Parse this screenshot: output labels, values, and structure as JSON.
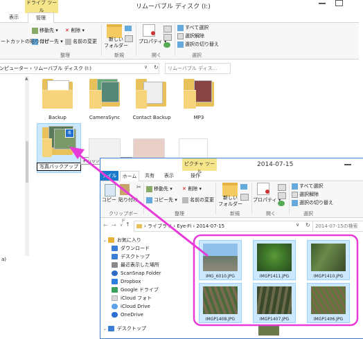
{
  "back_window": {
    "context_tab_top": "ドライブ ツール",
    "context_tab_bottom": "管理",
    "title": "リムーバブル ディスク (I:)",
    "tab_view": "表示",
    "ribbon": {
      "move_to": "移動先",
      "delete": "削除",
      "copy_to": "コピー先",
      "rename": "名前の変更",
      "paste_shortcut": "ョートカットの貼り付け",
      "new_folder": "新しい\nフォルダー",
      "properties": "プロパティ",
      "select_all": "すべて選択",
      "select_none": "選択解除",
      "invert_selection": "選択の切り替え",
      "group_organize": "整理",
      "group_new": "新規",
      "group_open": "開く",
      "group_select": "選択"
    },
    "address": "ンピューター › リムーバブル ディスク (I:)",
    "search_placeholder": "リムーバブル ディス...",
    "folders": [
      {
        "label": "Backup"
      },
      {
        "label": "CameraSync"
      },
      {
        "label": "Contact Backup"
      },
      {
        "label": "MP3"
      },
      {
        "label": "写真バックアップ"
      }
    ],
    "drag_tooltip": "+ バックアップ へコピー",
    "drag_badge": "6",
    "left_stub": "a)"
  },
  "front_window": {
    "context_tab_top": "",
    "context_tab_bottom": "ピクチャ ツール",
    "title": "2014-07-15",
    "tabs": {
      "file": "ァイル",
      "home": "ホーム",
      "share": "共有",
      "view": "表示",
      "manage": "操作"
    },
    "ribbon": {
      "copy": "コピー",
      "paste": "貼り付け",
      "move_to": "移動先",
      "copy_to": "コピー先",
      "delete": "削除",
      "rename": "名前の変更",
      "new_folder": "新しい\nフォルダー",
      "properties": "プロパティ",
      "select_all": "すべて選択",
      "select_none": "選択解除",
      "invert_selection": "選択の切り替え",
      "group_clipboard": "クリップボード",
      "group_organize": "整理",
      "group_new": "新規",
      "group_open": "開く",
      "group_select": "選択"
    },
    "address": {
      "seg1": "ライブラリ",
      "seg2": "Eye-Fi",
      "seg3": "2014-07-15"
    },
    "search_placeholder": "2014-07-15の検索",
    "nav": [
      {
        "label": "お気に入り",
        "color": "#e8b33b"
      },
      {
        "label": "ダウンロード",
        "color": "#3a7ed6"
      },
      {
        "label": "デスクトップ",
        "color": "#3a7ed6"
      },
      {
        "label": "最近表示した場所",
        "color": "#8a8a8a"
      },
      {
        "label": "ScanSnap Folder",
        "color": "#2c6cc9"
      },
      {
        "label": "Dropbox",
        "color": "#2c7fe0"
      },
      {
        "label": "Google ドライブ",
        "color": "#3aa35a"
      },
      {
        "label": "iCloud フォト",
        "color": "#d9d9d9"
      },
      {
        "label": "iCloud Drive",
        "color": "#5ba0e8"
      },
      {
        "label": "OneDrive",
        "color": "#2a6fd6"
      },
      {
        "label": "デスクトップ",
        "color": "#3a7ed6"
      }
    ],
    "thumbs": [
      {
        "name": "IMG_6010.JPG"
      },
      {
        "name": "IMGP1411.JPG"
      },
      {
        "name": "IMGP1410.JPG"
      },
      {
        "name": "IMGP1408.JPG"
      },
      {
        "name": "IMGP1407.JPG"
      },
      {
        "name": "IMGP1406.JPG"
      }
    ]
  },
  "colors": {
    "highlight": "#e83ad8",
    "selection": "#cce8ff",
    "file_tab": "#1979ca",
    "context_tab": "#f6e58a",
    "folder": "#f6d47b"
  }
}
